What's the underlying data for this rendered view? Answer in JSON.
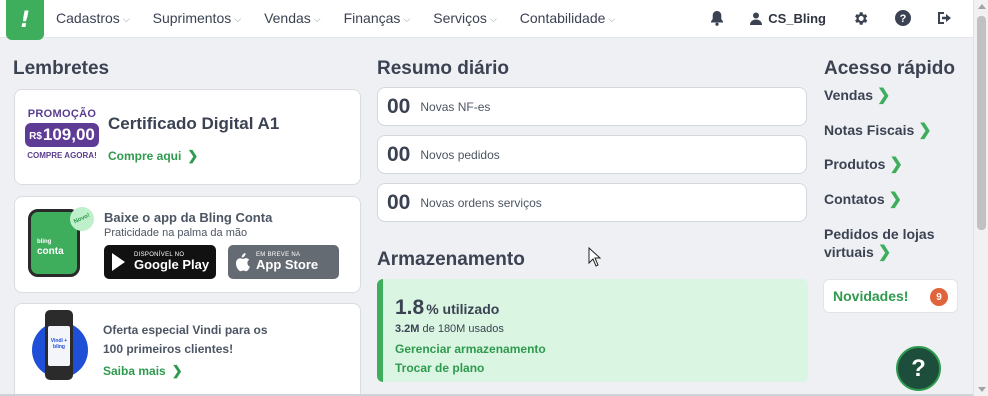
{
  "nav": {
    "logo": "!",
    "menu": [
      "Cadastros",
      "Suprimentos",
      "Vendas",
      "Finanças",
      "Serviços",
      "Contabilidade"
    ],
    "user": "CS_Bling",
    "icons": [
      "bell-icon",
      "user-icon",
      "gear-icon",
      "help-icon",
      "logout-icon"
    ]
  },
  "lembretes": {
    "title": "Lembretes",
    "certificado": {
      "promo_top": "PROMOÇÃO",
      "promo_currency": "R$",
      "promo_value": "109,00",
      "promo_bottom": "COMPRE AGORA!",
      "title": "Certificado Digital A1",
      "link": "Compre aqui"
    },
    "app": {
      "phone_label_small": "bling",
      "phone_label": "conta",
      "novo": "Novo!",
      "title": "Baixe o app da Bling Conta",
      "subtitle": "Praticidade na palma da mão",
      "google_small": "DISPONÍVEL NO",
      "google_big": "Google Play",
      "apple_small": "EM BREVE NA",
      "apple_big": "App Store"
    },
    "vindi": {
      "device_text": "Vindi + bling",
      "line1": "Oferta especial Vindi para os",
      "line2": "100 primeiros clientes!",
      "link": "Saiba mais"
    }
  },
  "resumo": {
    "title": "Resumo diário",
    "items": [
      {
        "num": "00",
        "label": "Novas NF-es"
      },
      {
        "num": "00",
        "label": "Novos pedidos"
      },
      {
        "num": "00",
        "label": "Novas ordens serviços"
      }
    ]
  },
  "armazenamento": {
    "title": "Armazenamento",
    "percent": "1.8",
    "percent_suffix": "% utilizado",
    "used": "3.2M",
    "used_suffix": "de 180M usados",
    "link_manage": "Gerenciar armazenamento",
    "link_plan": "Trocar de plano"
  },
  "acesso": {
    "title": "Acesso rápido",
    "items": [
      "Vendas",
      "Notas Fiscais",
      "Produtos",
      "Contatos"
    ],
    "item_multiline_1": "Pedidos de lojas",
    "item_multiline_2": "virtuais",
    "novidades": "Novidades!",
    "novidades_count": "9"
  },
  "help_fab": "?",
  "colors": {
    "brand_green": "#3fae5c",
    "link_green": "#2f9a4e",
    "promo_purple": "#5e3b95",
    "badge_orange": "#e0643c"
  }
}
